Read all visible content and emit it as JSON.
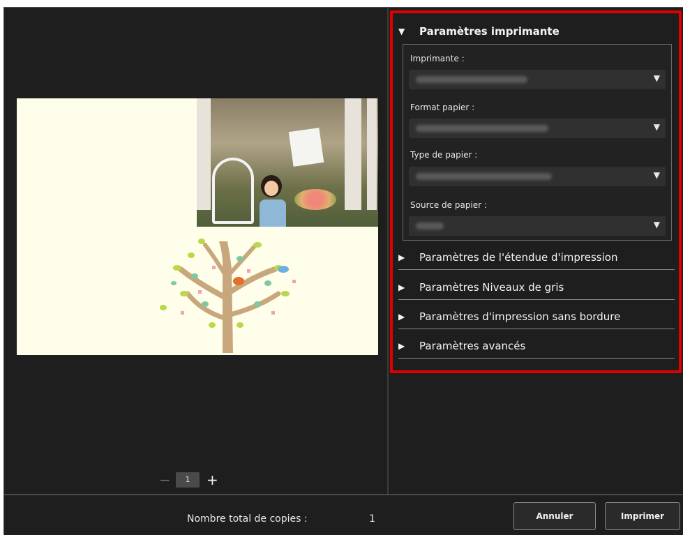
{
  "printer_settings": {
    "title": "Paramètres imprimante",
    "fields": [
      {
        "label": "Imprimante :"
      },
      {
        "label": "Format papier :"
      },
      {
        "label": "Type de papier :"
      },
      {
        "label": "Source de papier :"
      }
    ]
  },
  "collapsed_sections": [
    "Paramètres de l'étendue d'impression",
    "Paramètres Niveaux de gris",
    "Paramètres d'impression sans bordure",
    "Paramètres avancés"
  ],
  "pager": {
    "minus": "−",
    "page": "1",
    "plus": "+"
  },
  "footer": {
    "copies_label": "Nombre total de copies :",
    "copies_value": "1",
    "cancel_label": "Annuler",
    "print_label": "Imprimer"
  },
  "icons": {
    "expanded": "triangle-down-icon",
    "collapsed": "triangle-right-icon",
    "dropdown": "chevron-down-icon"
  },
  "colors": {
    "highlight": "#e10000",
    "background": "#1e1e1e",
    "page": "#fefeea"
  }
}
